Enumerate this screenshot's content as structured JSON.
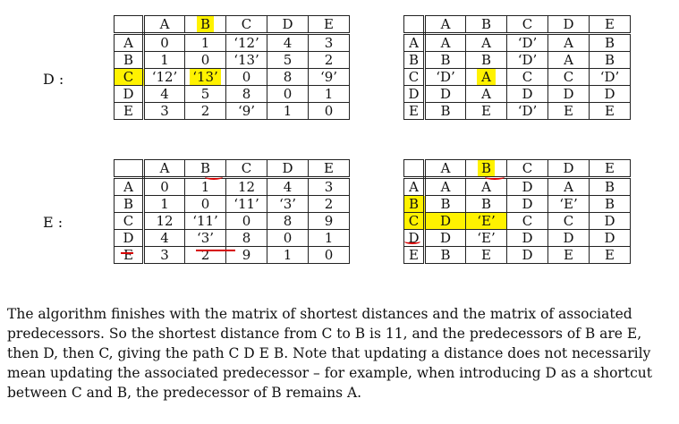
{
  "blocks": [
    {
      "label": "D :",
      "distance": {
        "cols": [
          "A",
          "B",
          "C",
          "D",
          "E"
        ],
        "rows": [
          {
            "h": "A",
            "c": [
              "0",
              "1",
              "‘12’",
              "4",
              "3"
            ]
          },
          {
            "h": "B",
            "c": [
              "1",
              "0",
              "‘13’",
              "5",
              "2"
            ]
          },
          {
            "h": "C",
            "c": [
              "‘12’",
              "‘13’",
              "0",
              "8",
              "‘9’"
            ]
          },
          {
            "h": "D",
            "c": [
              "4",
              "5",
              "8",
              "0",
              "1"
            ]
          },
          {
            "h": "E",
            "c": [
              "3",
              "2",
              "‘9’",
              "1",
              "0"
            ]
          }
        ]
      },
      "predecessor": {
        "cols": [
          "A",
          "B",
          "C",
          "D",
          "E"
        ],
        "rows": [
          {
            "h": "A",
            "c": [
              "A",
              "A",
              "‘D’",
              "A",
              "B"
            ]
          },
          {
            "h": "B",
            "c": [
              "B",
              "B",
              "‘D’",
              "A",
              "B"
            ]
          },
          {
            "h": "C",
            "c": [
              "‘D’",
              "A",
              "C",
              "C",
              "‘D’"
            ]
          },
          {
            "h": "D",
            "c": [
              "D",
              "A",
              "D",
              "D",
              "D"
            ]
          },
          {
            "h": "E",
            "c": [
              "B",
              "E",
              "‘D’",
              "E",
              "E"
            ]
          }
        ]
      }
    },
    {
      "label": "E :",
      "distance": {
        "cols": [
          "A",
          "B",
          "C",
          "D",
          "E"
        ],
        "rows": [
          {
            "h": "A",
            "c": [
              "0",
              "1",
              "12",
              "4",
              "3"
            ]
          },
          {
            "h": "B",
            "c": [
              "1",
              "0",
              "‘11’",
              "‘3’",
              "2"
            ]
          },
          {
            "h": "C",
            "c": [
              "12",
              "‘11’",
              "0",
              "8",
              "9"
            ]
          },
          {
            "h": "D",
            "c": [
              "4",
              "‘3’",
              "8",
              "0",
              "1"
            ]
          },
          {
            "h": "E",
            "c": [
              "3",
              "2",
              "9",
              "1",
              "0"
            ]
          }
        ]
      },
      "predecessor": {
        "cols": [
          "A",
          "B",
          "C",
          "D",
          "E"
        ],
        "rows": [
          {
            "h": "A",
            "c": [
              "A",
              "A",
              "D",
              "A",
              "B"
            ]
          },
          {
            "h": "B",
            "c": [
              "B",
              "B",
              "D",
              "‘E’",
              "B"
            ]
          },
          {
            "h": "C",
            "c": [
              "D",
              "‘E’",
              "C",
              "C",
              "D"
            ]
          },
          {
            "h": "D",
            "c": [
              "D",
              "‘E’",
              "D",
              "D",
              "D"
            ]
          },
          {
            "h": "E",
            "c": [
              "B",
              "E",
              "D",
              "E",
              "E"
            ]
          }
        ]
      }
    }
  ],
  "paragraph": "The algorithm finishes with the matrix of shortest distances and the matrix of associated predecessors. So the shortest distance from C to B is 11, and the predecessors of B are E, then D, then C, giving the path C D E B. Note that updating a distance does not necessarily mean updating the associated predecessor – for example, when introducing D as a shortcut between C and B, the predecessor of B remains A.",
  "colors": {
    "highlight": "#fff200",
    "annotation": "#d60000"
  }
}
